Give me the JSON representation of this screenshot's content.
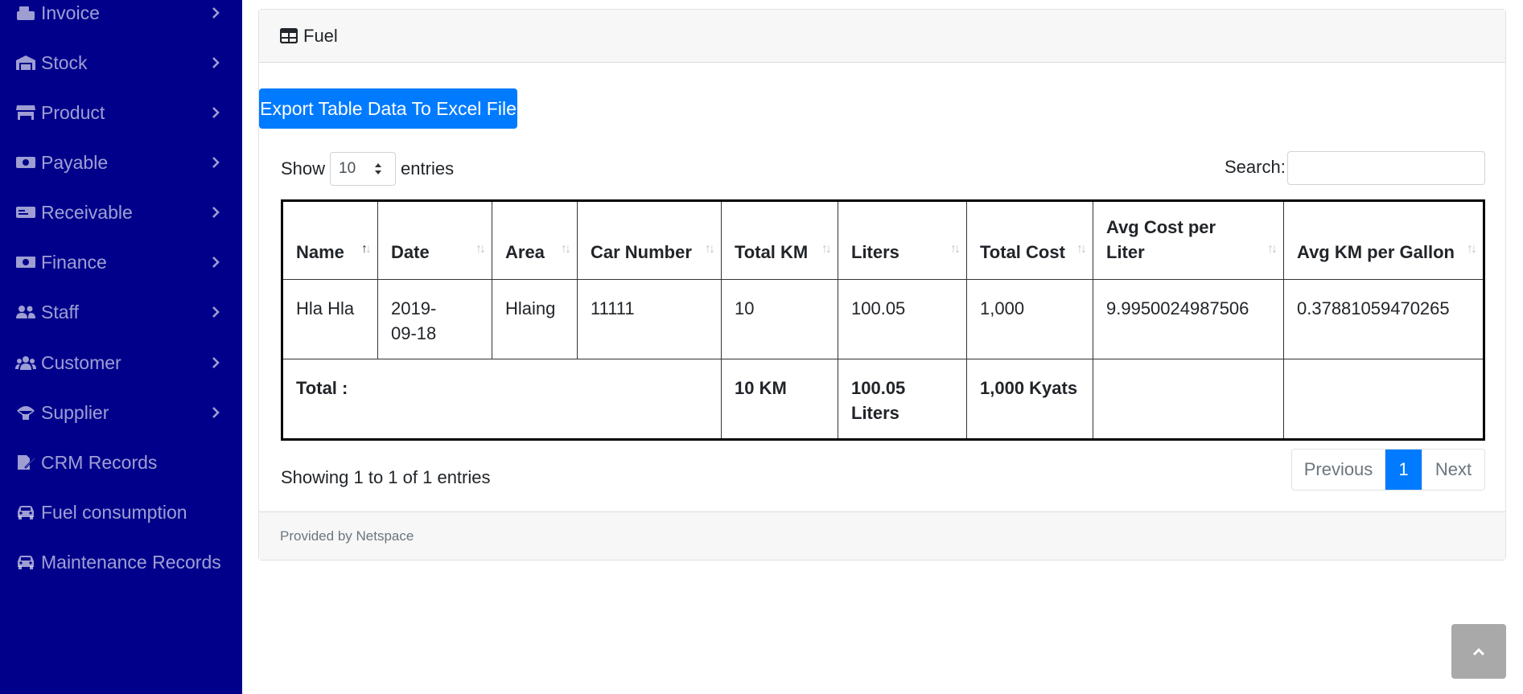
{
  "sidebar": {
    "items": [
      {
        "label": "Invoice",
        "icon": "cash-register-icon",
        "chevron": true
      },
      {
        "label": "Stock",
        "icon": "warehouse-icon",
        "chevron": true
      },
      {
        "label": "Product",
        "icon": "store-icon",
        "chevron": true
      },
      {
        "label": "Payable",
        "icon": "money-bill-icon",
        "chevron": true
      },
      {
        "label": "Receivable",
        "icon": "money-check-icon",
        "chevron": true
      },
      {
        "label": "Finance",
        "icon": "money-bill-wave-icon",
        "chevron": true
      },
      {
        "label": "Staff",
        "icon": "user-friends-icon",
        "chevron": true
      },
      {
        "label": "Customer",
        "icon": "users-icon",
        "chevron": true
      },
      {
        "label": "Supplier",
        "icon": "parachute-box-icon",
        "chevron": true
      },
      {
        "label": "CRM Records",
        "icon": "file-signature-icon",
        "chevron": false
      },
      {
        "label": "Fuel consumption",
        "icon": "car-icon",
        "chevron": false
      },
      {
        "label": "Maintenance Records",
        "icon": "car-icon",
        "chevron": false
      }
    ]
  },
  "card": {
    "title": "Fuel",
    "title_icon": "table-icon",
    "export_label": "Export Table Data To Excel File",
    "show_label": "Show",
    "entries_value": "10",
    "entries_label": "entries",
    "search_label": "Search:",
    "search_value": "",
    "footer": "Provided by Netspace"
  },
  "table": {
    "headers": [
      "Name",
      "Date",
      "Area",
      "Car Number",
      "Total KM",
      "Liters",
      "Total Cost",
      "Avg Cost per Liter",
      "Avg KM per Gallon"
    ],
    "rows": [
      [
        "Hla Hla",
        "2019-09-18",
        "Hlaing",
        "11111",
        "10",
        "100.05",
        "1,000",
        "9.9950024987506",
        "0.37881059470265"
      ]
    ],
    "totals": {
      "label": "Total :",
      "km": "10 KM",
      "liters": "100.05 Liters",
      "cost": "1,000 Kyats"
    }
  },
  "pagination": {
    "info": "Showing 1 to 1 of 1 entries",
    "previous": "Previous",
    "current": "1",
    "next": "Next"
  },
  "colors": {
    "sidebar_bg": "#00008b",
    "primary": "#007bff"
  }
}
